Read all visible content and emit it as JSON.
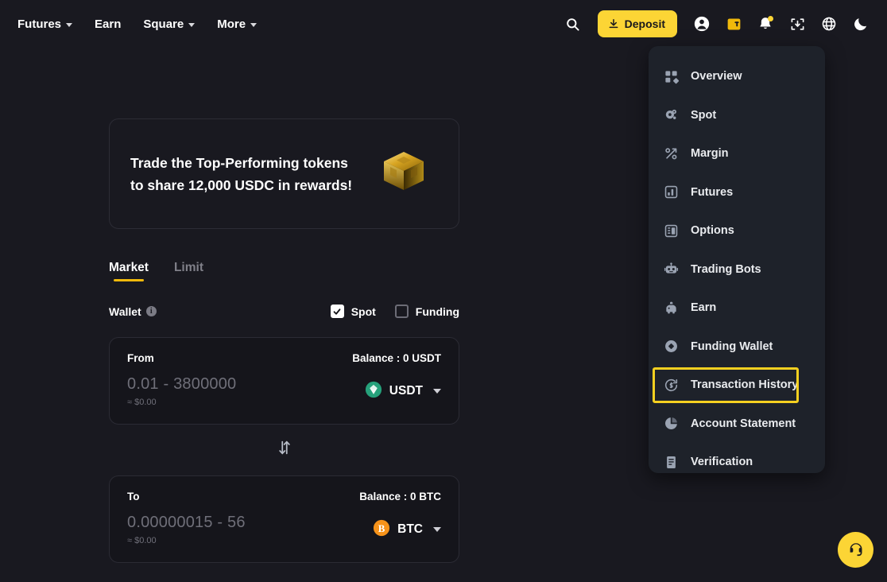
{
  "topnav": {
    "links": [
      {
        "label": "Futures",
        "caret": true,
        "icon": "chevron-down-icon"
      },
      {
        "label": "Earn",
        "caret": false,
        "icon": ""
      },
      {
        "label": "Square",
        "caret": true,
        "icon": "chevron-down-icon"
      },
      {
        "label": "More",
        "caret": true,
        "icon": "chevron-down-icon"
      }
    ],
    "search_icon": "search-icon",
    "deposit_label": "Deposit",
    "deposit_icon": "download-icon",
    "right_icons": [
      {
        "name": "user-account-icon"
      },
      {
        "name": "wallet-icon"
      },
      {
        "name": "notifications-bell-icon"
      },
      {
        "name": "download-app-icon"
      },
      {
        "name": "language-globe-icon"
      },
      {
        "name": "dark-mode-moon-icon"
      }
    ]
  },
  "dropdown": {
    "items": [
      {
        "label": "Overview",
        "icon": "dashboard-grid-icon",
        "highlighted": false
      },
      {
        "label": "Spot",
        "icon": "spot-coins-icon",
        "highlighted": false
      },
      {
        "label": "Margin",
        "icon": "margin-percent-icon",
        "highlighted": false
      },
      {
        "label": "Futures",
        "icon": "futures-chart-icon",
        "highlighted": false
      },
      {
        "label": "Options",
        "icon": "options-icon",
        "highlighted": false
      },
      {
        "label": "Trading Bots",
        "icon": "robot-icon",
        "highlighted": false
      },
      {
        "label": "Earn",
        "icon": "piggy-bank-icon",
        "highlighted": false
      },
      {
        "label": "Funding Wallet",
        "icon": "funding-diamond-icon",
        "highlighted": false
      },
      {
        "label": "Transaction History",
        "icon": "transaction-history-clock-icon",
        "highlighted": true
      },
      {
        "label": "Account Statement",
        "icon": "pie-chart-icon",
        "highlighted": false
      },
      {
        "label": "Verification",
        "icon": "document-verification-icon",
        "highlighted": false
      }
    ],
    "highlight_color": "#f5d020"
  },
  "promo": {
    "text": "Trade the Top-Performing tokens to share 12,000 USDC in rewards!",
    "image_name": "gold-cube-image"
  },
  "tabs": [
    {
      "label": "Market",
      "active": true
    },
    {
      "label": "Limit",
      "active": false
    }
  ],
  "wallet": {
    "label": "Wallet",
    "info_icon": "info-icon",
    "options": [
      {
        "label": "Spot",
        "checked": true
      },
      {
        "label": "Funding",
        "checked": false
      }
    ]
  },
  "convert": {
    "from": {
      "side": "From",
      "balance": "Balance : 0 USDT",
      "amount_placeholder": "0.01 - 3800000",
      "approx": "≈ $0.00",
      "token": "USDT",
      "token_icon": "usdt-coin-icon",
      "token_color": "#26a17b"
    },
    "swap_icon": "swap-vertical-arrows-icon",
    "to": {
      "side": "To",
      "balance": "Balance : 0 BTC",
      "amount_placeholder": "0.00000015 - 56",
      "approx": "≈ $0.00",
      "token": "BTC",
      "token_icon": "btc-coin-icon",
      "token_color": "#f7931a"
    }
  },
  "support": {
    "icon": "customer-support-headset-icon",
    "color": "#fcd535"
  }
}
